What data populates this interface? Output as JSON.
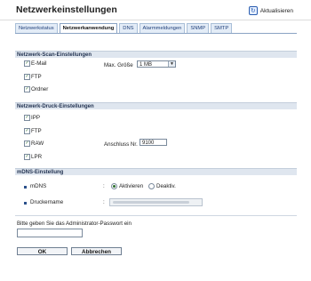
{
  "header": {
    "title": "Netzwerkeinstellungen",
    "refresh_label": "Aktualisieren"
  },
  "tabs": [
    {
      "label": "Netzwerkstatus",
      "active": false
    },
    {
      "label": "Netzwerkanwendung",
      "active": true
    },
    {
      "label": "DNS",
      "active": false
    },
    {
      "label": "Alarmmeldungen",
      "active": false
    },
    {
      "label": "SNMP",
      "active": false
    },
    {
      "label": "SMTP",
      "active": false
    }
  ],
  "scan": {
    "title": "Netzwerk-Scan-Einstellungen",
    "items": [
      {
        "label": "E-Mail",
        "checked": true
      },
      {
        "label": "FTP",
        "checked": true
      },
      {
        "label": "Ordner",
        "checked": true
      }
    ],
    "max_size_label": "Max. Größe",
    "max_size_value": "1 MB"
  },
  "print": {
    "title": "Netzwerk-Druck-Einstellungen",
    "items": [
      {
        "label": "IPP",
        "checked": true
      },
      {
        "label": "FTP",
        "checked": true
      },
      {
        "label": "RAW",
        "checked": true
      },
      {
        "label": "LPR",
        "checked": true
      }
    ],
    "port_label": "Anschluss Nr.",
    "port_value": "9100"
  },
  "mdns": {
    "title": "mDNS-Einstellung",
    "mdns_label": "mDNS",
    "separator": ":",
    "option_on": "Aktivieren",
    "option_off": "Deaktiv.",
    "selected": "on",
    "printer_name_label": "Druckername"
  },
  "password": {
    "prompt": "Bitte geben Sie das Administrator-Passwort ein",
    "value": ""
  },
  "buttons": {
    "ok": "OK",
    "cancel": "Abbrechen"
  }
}
